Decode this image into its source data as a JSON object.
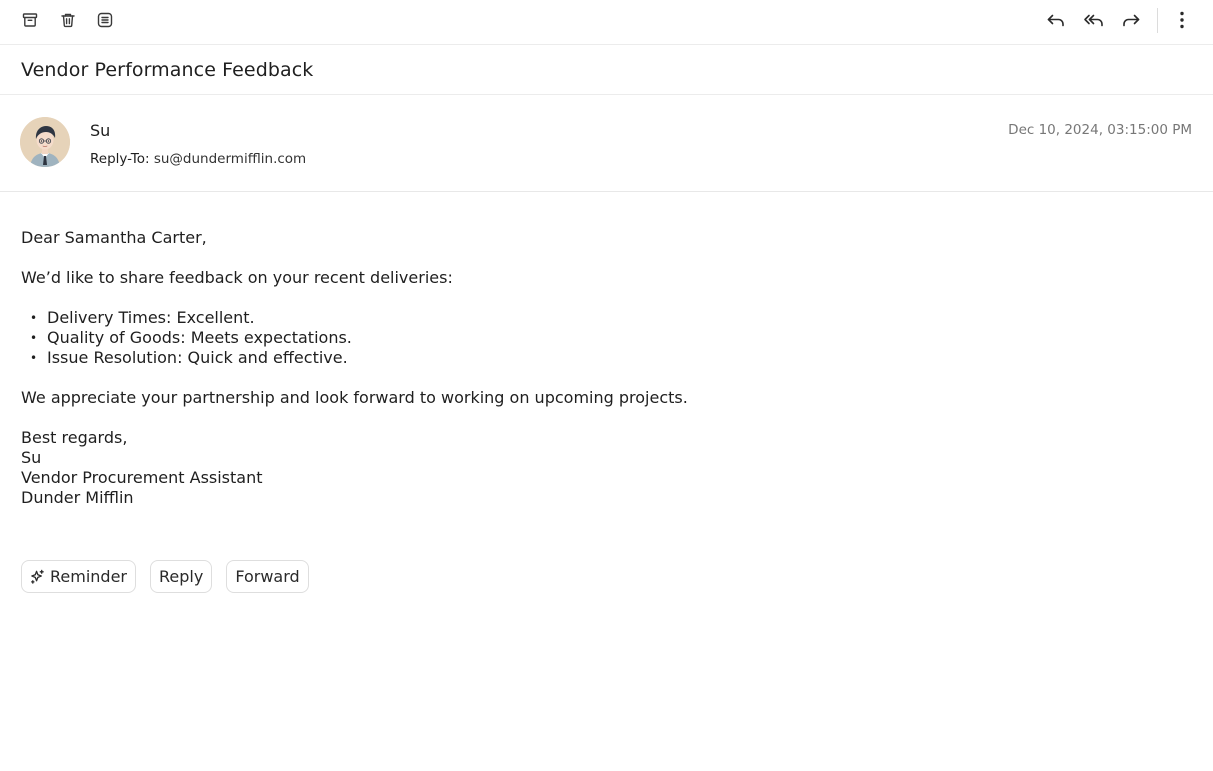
{
  "toolbar": {
    "left_icons": [
      "archive-icon",
      "trash-icon",
      "list-view-icon"
    ],
    "right_icons": [
      "reply-icon",
      "reply-all-icon",
      "forward-icon",
      "more-vertical-icon"
    ]
  },
  "email": {
    "subject": "Vendor Performance Feedback",
    "sender_name": "Su",
    "reply_to_label": "Reply-To:",
    "reply_to_address": "su@dundermifflin.com",
    "date": "Dec 10, 2024, 03:15:00 PM",
    "body": {
      "greeting": "Dear Samantha Carter,",
      "intro": "We’d like to share feedback on your recent deliveries:",
      "bullets": [
        "Delivery Times: Excellent.",
        "Quality of Goods: Meets expectations.",
        "Issue Resolution: Quick and effective."
      ],
      "closing_line": "We appreciate your partnership and look forward to working on upcoming projects.",
      "signoff": "Best regards,",
      "signature_name": "Su",
      "signature_title": "Vendor Procurement Assistant",
      "signature_company": "Dunder Mifflin"
    }
  },
  "actions": {
    "reminder_label": "Reminder",
    "reply_label": "Reply",
    "forward_label": "Forward"
  },
  "colors": {
    "avatar_bg": "#e6d3b9",
    "border": "#ececec",
    "muted_text": "#777777"
  }
}
